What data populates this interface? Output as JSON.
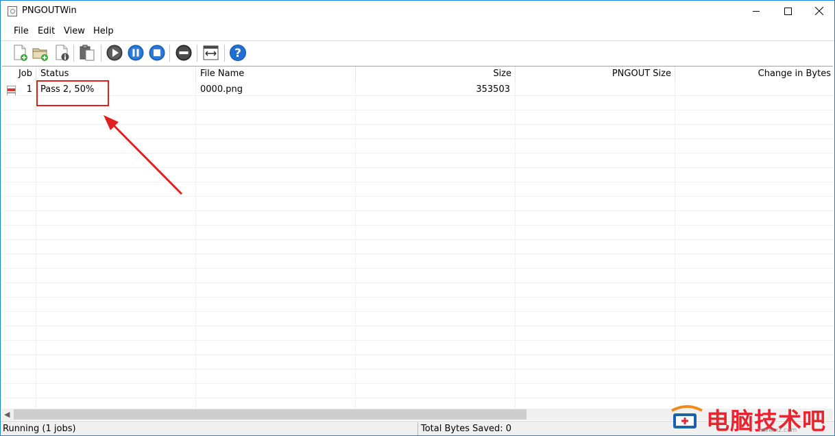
{
  "window": {
    "title": "PNGOUTWin"
  },
  "menu": {
    "items": [
      "File",
      "Edit",
      "View",
      "Help"
    ]
  },
  "toolbar": {
    "buttons": [
      {
        "icon": "add-file-icon"
      },
      {
        "icon": "add-folder-icon"
      },
      {
        "icon": "file-info-icon"
      },
      {
        "icon": "paste-icon"
      },
      {
        "icon": "play-icon"
      },
      {
        "icon": "pause-icon"
      },
      {
        "icon": "stop-icon"
      },
      {
        "icon": "remove-icon"
      },
      {
        "icon": "fit-columns-icon"
      },
      {
        "icon": "help-icon"
      }
    ]
  },
  "table": {
    "columns": [
      "Job",
      "Status",
      "File Name",
      "Size",
      "PNGOUT Size",
      "Change in Bytes"
    ],
    "rows": [
      {
        "job": "1",
        "status": "Pass 2, 50%",
        "file_name": "0000.png",
        "size": "353503",
        "pngout_size": "",
        "change": ""
      }
    ]
  },
  "statusbar": {
    "left": "Running (1 jobs)",
    "right": "Total Bytes Saved: 0"
  },
  "watermark": {
    "text": "电脑技术吧",
    "url": "www.xz.com"
  },
  "colors": {
    "highlight": "#e02020",
    "accent": "#2f7bd6",
    "watermark": "#e8242f"
  }
}
